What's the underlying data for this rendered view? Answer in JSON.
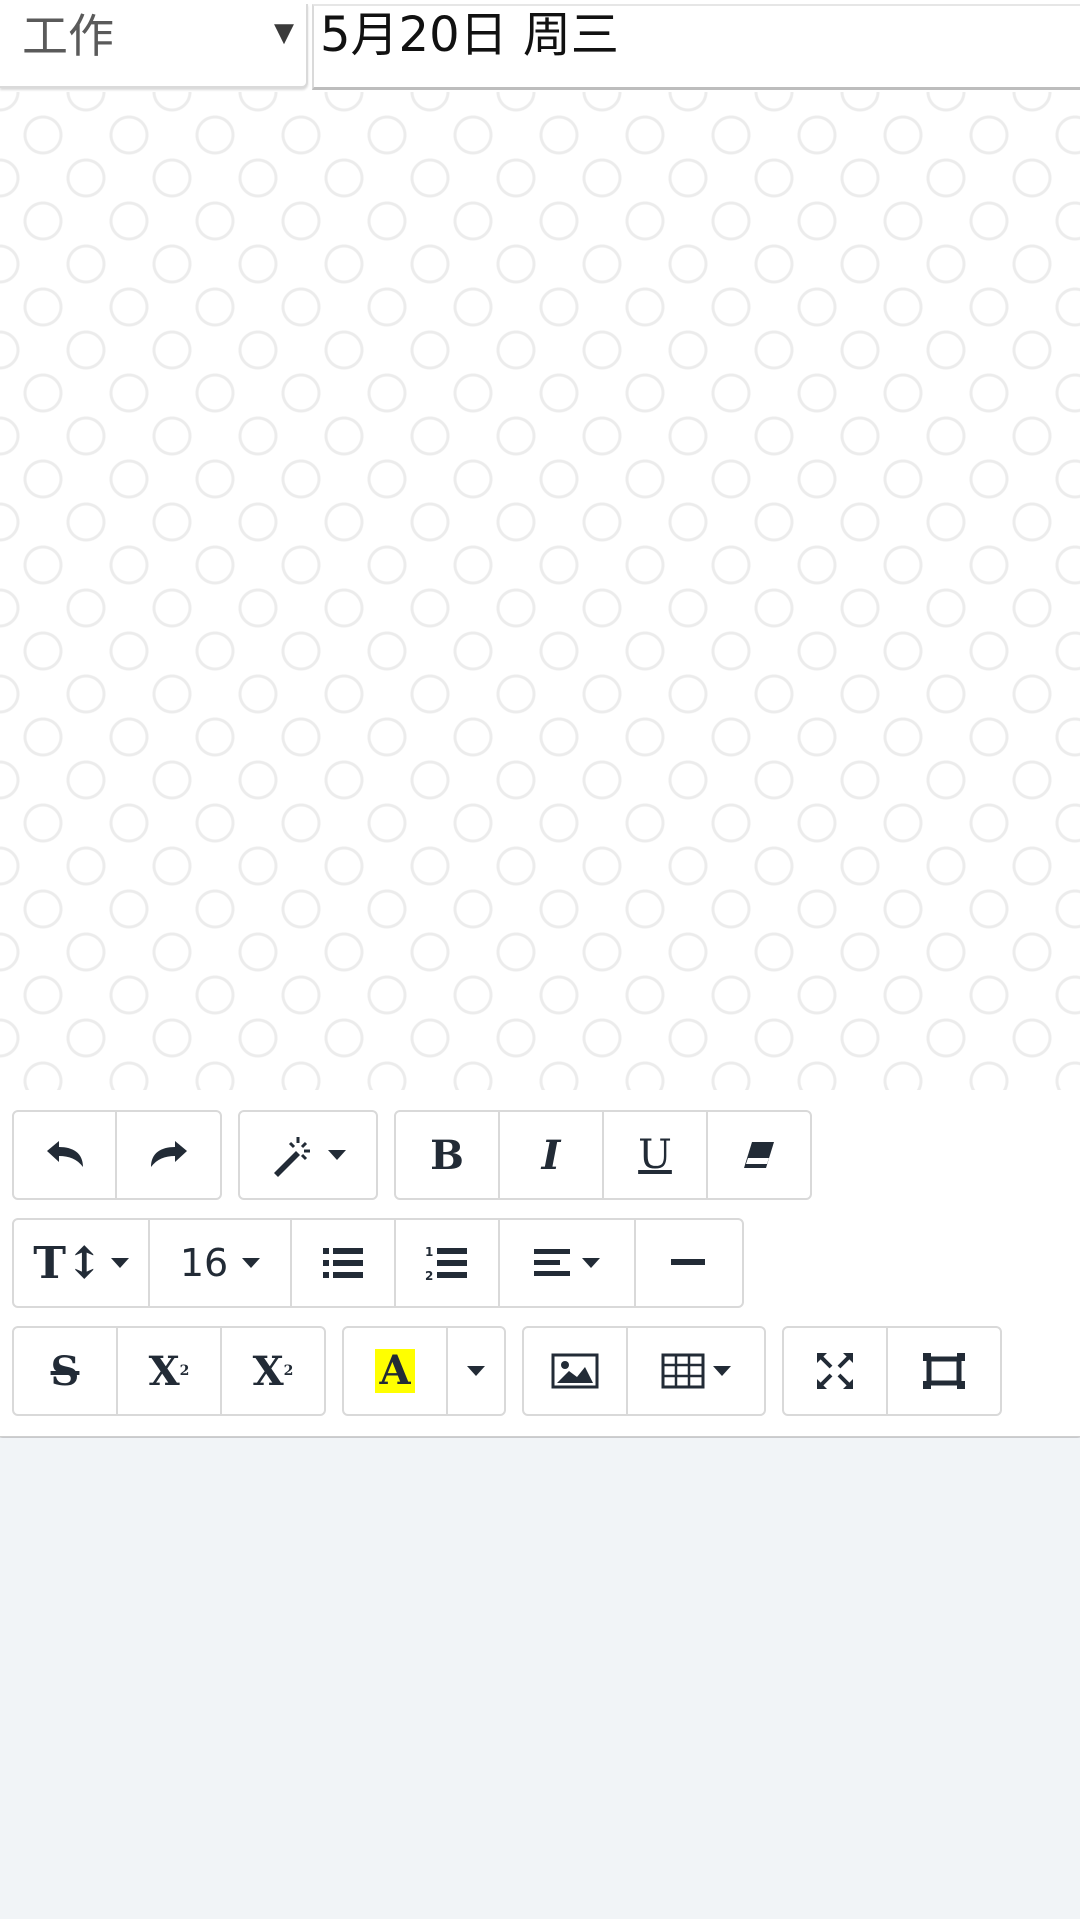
{
  "header": {
    "category_value": "工作",
    "category_arrow": "▼",
    "date_value": "5月20日 周三"
  },
  "toolbar": {
    "font_size_value": "16",
    "bold_label": "B",
    "italic_label": "I",
    "underline_label": "U",
    "strikethrough_label": "S",
    "superscript_label": "X",
    "subscript_label": "X",
    "font_color_label": "A",
    "highlight_color": "#ffff00"
  },
  "colors": {
    "icon": "#222b36",
    "page_background": "#f1f4f7"
  }
}
